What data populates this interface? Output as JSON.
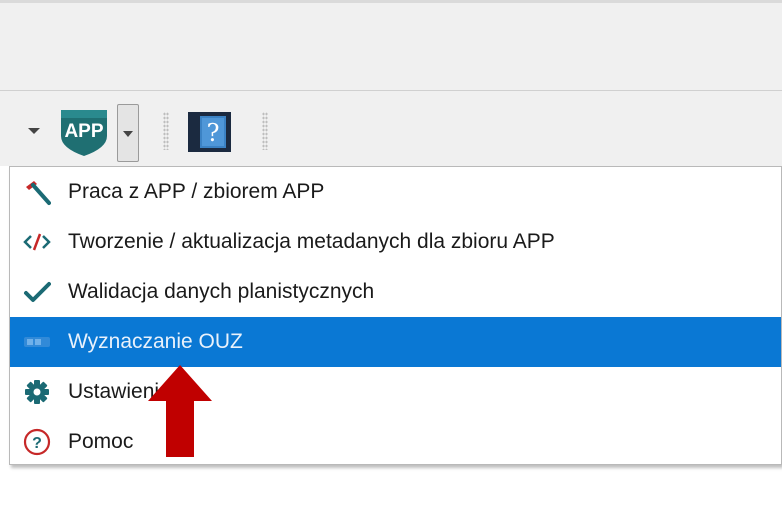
{
  "toolbar": {
    "app_icon_text": "APP",
    "help_icon_glyph": "?"
  },
  "menu": {
    "items": [
      {
        "label": "Praca z APP / zbiorem APP",
        "icon": "hammer-icon"
      },
      {
        "label": "Tworzenie / aktualizacja metadanych dla zbioru APP",
        "icon": "code-tag-icon"
      },
      {
        "label": "Walidacja danych planistycznych",
        "icon": "checkmark-icon"
      },
      {
        "label": "Wyznaczanie OUZ",
        "icon": "ouz-icon",
        "selected": true
      },
      {
        "label": "Ustawienia",
        "icon": "gear-icon"
      },
      {
        "label": "Pomoc",
        "icon": "help-circle-icon"
      }
    ]
  },
  "colors": {
    "selection": "#0a78d4",
    "app_teal": "#1f6f72",
    "hammer_red": "#c62828",
    "check_teal": "#1b6a74",
    "pointer_arrow": "#c00000"
  }
}
